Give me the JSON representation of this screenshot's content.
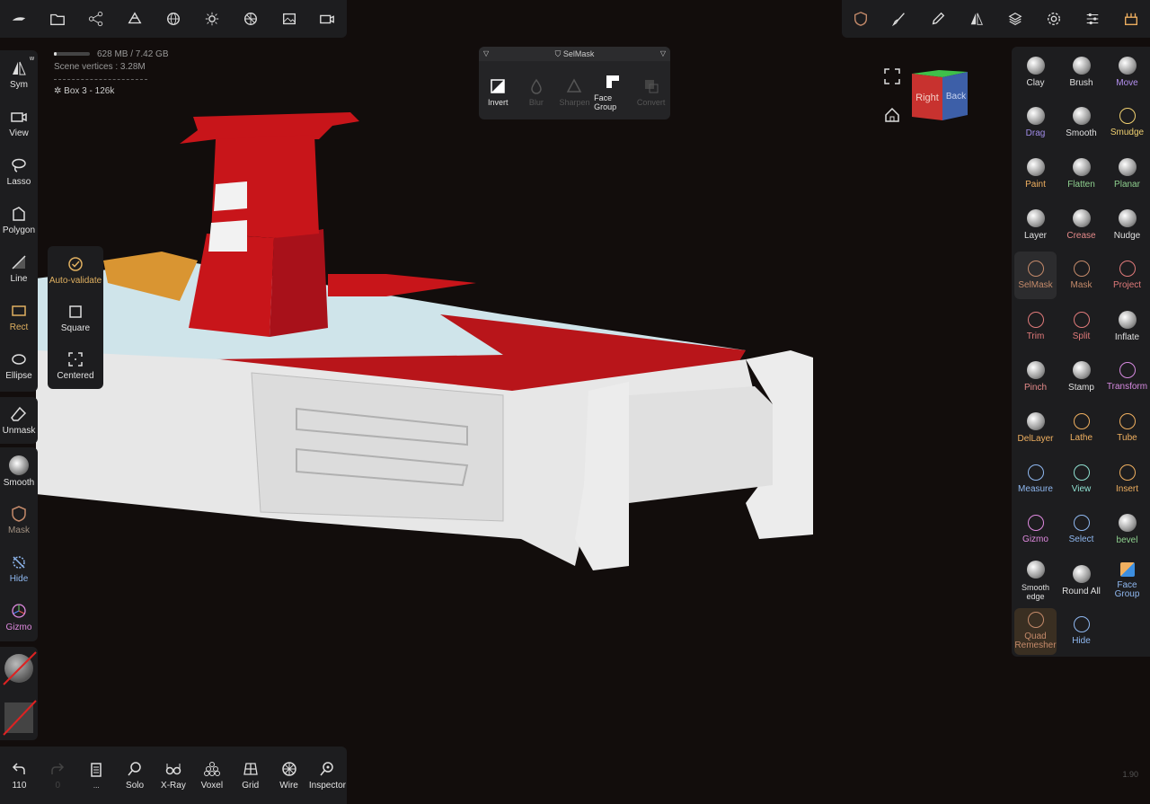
{
  "stats": {
    "memory": "628 MB / 7.42 GB",
    "vertices": "Scene vertices : 3.28M",
    "memory_fraction": 0.085,
    "object": "Box 3 - 126k"
  },
  "top_left_icons": [
    "home-shape-icon",
    "folder-icon",
    "share-graph-icon",
    "scene-tree-icon",
    "sphere-wire-icon",
    "sun-icon",
    "material-icon",
    "image-icon",
    "camera-icon"
  ],
  "top_right_icons": [
    "selmask-shield-icon",
    "paint-brush-icon",
    "picker-icon",
    "symmetry-icon",
    "layers-icon",
    "settings-gear-icon",
    "sliders-icon",
    "toolbox-icon"
  ],
  "left_tools": {
    "sym": "Sym",
    "sym_badge": "w",
    "view": "View",
    "lasso": "Lasso",
    "polygon": "Polygon",
    "line": "Line",
    "rect": "Rect",
    "ellipse": "Ellipse",
    "unmask": "Unmask",
    "smooth": "Smooth",
    "mask": "Mask",
    "hide": "Hide",
    "gizmo": "Gizmo"
  },
  "rect_submenu": {
    "auto_validate": "Auto-validate",
    "square": "Square",
    "centered": "Centered"
  },
  "selmask": {
    "title": "SelMask",
    "invert": "Invert",
    "blur": "Blur",
    "sharpen": "Sharpen",
    "face_group": "Face Group",
    "convert": "Convert"
  },
  "viewcube": {
    "right": "Right",
    "back": "Back"
  },
  "right_tools": [
    {
      "label": "Clay",
      "color": "#e0e0e0"
    },
    {
      "label": "Brush",
      "color": "#e0e0e0"
    },
    {
      "label": "Move",
      "color": "#b490f0"
    },
    {
      "label": "Drag",
      "color": "#a08ce8"
    },
    {
      "label": "Smooth",
      "color": "#e0e0e0"
    },
    {
      "label": "Smudge",
      "color": "#f0d070"
    },
    {
      "label": "Paint",
      "color": "#f0b060"
    },
    {
      "label": "Flatten",
      "color": "#8fd18f"
    },
    {
      "label": "Planar",
      "color": "#8fd18f"
    },
    {
      "label": "Layer",
      "color": "#e0e0e0"
    },
    {
      "label": "Crease",
      "color": "#e58a8a"
    },
    {
      "label": "Nudge",
      "color": "#e0e0e0"
    },
    {
      "label": "SelMask",
      "color": "#c48a6a"
    },
    {
      "label": "Mask",
      "color": "#c48a6a"
    },
    {
      "label": "Project",
      "color": "#e07a7a"
    },
    {
      "label": "Trim",
      "color": "#e07a7a"
    },
    {
      "label": "Split",
      "color": "#e07a7a"
    },
    {
      "label": "Inflate",
      "color": "#e0e0e0"
    },
    {
      "label": "Pinch",
      "color": "#e58a8a"
    },
    {
      "label": "Stamp",
      "color": "#e0e0e0"
    },
    {
      "label": "Transform",
      "color": "#d68ae0"
    },
    {
      "label": "DelLayer",
      "color": "#f0b060"
    },
    {
      "label": "Lathe",
      "color": "#f0b060"
    },
    {
      "label": "Tube",
      "color": "#f0b060"
    },
    {
      "label": "Measure",
      "color": "#8fb8f0"
    },
    {
      "label": "View",
      "color": "#8fe0d0"
    },
    {
      "label": "Insert",
      "color": "#f0b060"
    },
    {
      "label": "Gizmo",
      "color": "#e08ae0"
    },
    {
      "label": "Select",
      "color": "#8fb8f0"
    },
    {
      "label": "bevel",
      "color": "#8fd18f"
    },
    {
      "label": "Smooth edge",
      "color": "#e0e0e0"
    },
    {
      "label": "Round All",
      "color": "#e0e0e0"
    },
    {
      "label": "Face Group",
      "color": "#8fb8f0"
    },
    {
      "label": "Quad Remesher",
      "color": "#c48a6a"
    },
    {
      "label": "Hide",
      "color": "#8fb8f0"
    }
  ],
  "bottom_tools": {
    "undo": "110",
    "redo": "0",
    "history": "...",
    "solo": "Solo",
    "xray": "X-Ray",
    "voxel": "Voxel",
    "grid": "Grid",
    "wire": "Wire",
    "inspector": "Inspector"
  },
  "version": "1.90"
}
